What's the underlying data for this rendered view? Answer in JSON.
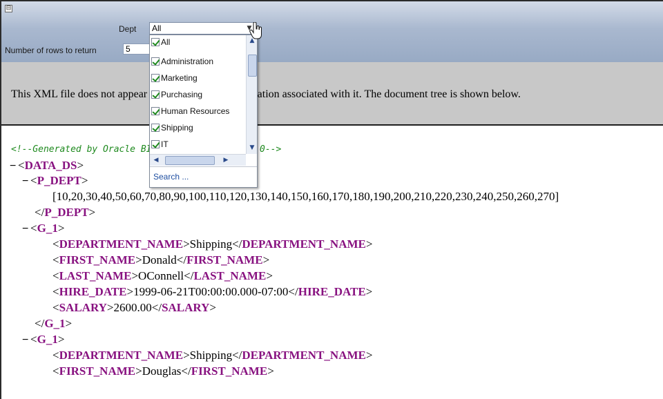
{
  "params": {
    "collapse_symbol": "⊟",
    "dept_label": "Dept",
    "dept_selected": "All",
    "rows_label": "Number of rows to return",
    "rows_value": "5"
  },
  "dropdown": {
    "options": [
      {
        "label": "All",
        "checked": true
      },
      {
        "label": "Administration",
        "checked": true
      },
      {
        "label": "Marketing",
        "checked": true
      },
      {
        "label": "Purchasing",
        "checked": true
      },
      {
        "label": "Human Resources",
        "checked": true
      },
      {
        "label": "Shipping",
        "checked": true
      },
      {
        "label": "IT",
        "checked": true
      }
    ],
    "search_link": "Search ..."
  },
  "banner": {
    "text": "This XML file does not appear to have any style information associated with it. The document tree is shown below."
  },
  "xml": {
    "comment": "<!--Generated by Oracle BI Publisher 11.1.1.6.0-->",
    "lines": [
      {
        "toggle": "−",
        "open": "DATA_DS"
      },
      {
        "toggle": "−",
        "open": "P_DEPT"
      },
      {
        "text": "[10,20,30,40,50,60,70,80,90,100,110,120,130,140,150,160,170,180,190,200,210,220,230,240,250,260,270]"
      },
      {
        "close": "P_DEPT"
      },
      {
        "toggle": "−",
        "open": "G_1"
      },
      {
        "tag": "DEPARTMENT_NAME",
        "value": "Shipping"
      },
      {
        "tag": "FIRST_NAME",
        "value": "Donald"
      },
      {
        "tag": "LAST_NAME",
        "value": "OConnell"
      },
      {
        "tag": "HIRE_DATE",
        "value": "1999-06-21T00:00:00.000-07:00"
      },
      {
        "tag": "SALARY",
        "value": "2600.00"
      },
      {
        "close": "G_1"
      },
      {
        "toggle": "−",
        "open": "G_1"
      },
      {
        "tag": "DEPARTMENT_NAME",
        "value": "Shipping"
      },
      {
        "tag": "FIRST_NAME",
        "value": "Douglas"
      }
    ]
  }
}
